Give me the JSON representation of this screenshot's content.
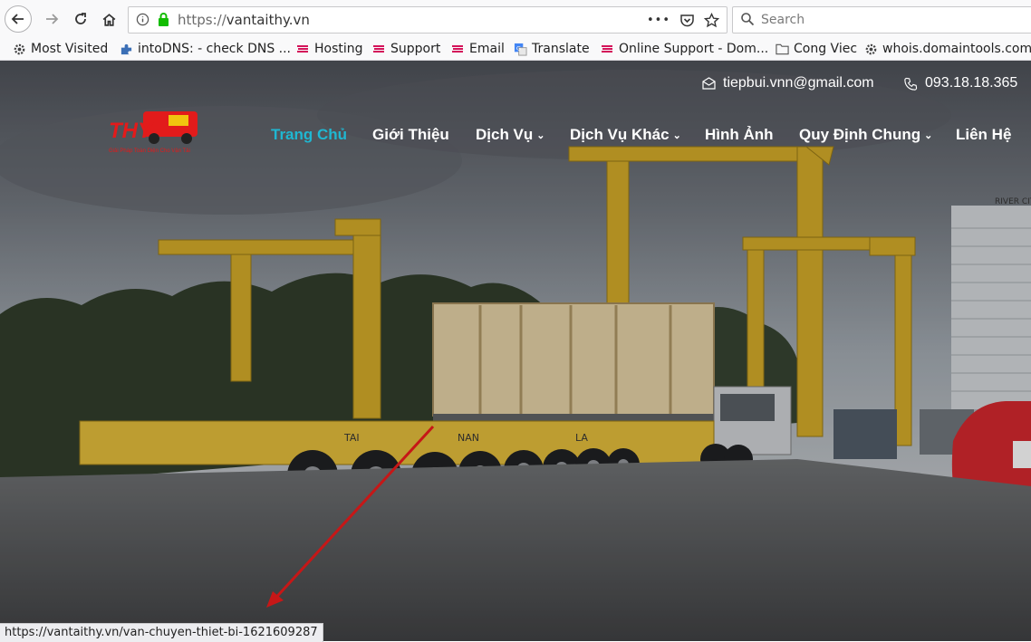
{
  "browser": {
    "url_scheme": "https://",
    "url_host": "vantaithy.vn",
    "search_placeholder": "Search",
    "page_actions_label": "•••"
  },
  "bookmarks": [
    {
      "label": "Most Visited",
      "icon": "gear-icon"
    },
    {
      "label": "intoDNS: - check DNS ...",
      "icon": "puzzle-icon"
    },
    {
      "label": "Hosting",
      "icon": "mat-bao-icon"
    },
    {
      "label": "Support",
      "icon": "mat-bao-icon"
    },
    {
      "label": "Email",
      "icon": "mat-bao-icon"
    },
    {
      "label": "Translate",
      "icon": "translate-icon"
    },
    {
      "label": "Online Support - Dom...",
      "icon": "mat-bao-icon"
    },
    {
      "label": "Cong Viec",
      "icon": "folder-icon"
    },
    {
      "label": "whois.domaintools.com",
      "icon": "gear-icon"
    }
  ],
  "site": {
    "logo_text": "THY",
    "logo_tagline": "Giải Pháp Toàn Diện Cho Vận Tải",
    "email": "tiepbui.vnn@gmail.com",
    "phone": "093.18.18.365",
    "menu": [
      {
        "label": "Trang Chủ",
        "active": true,
        "dropdown": false
      },
      {
        "label": "Giới Thiệu",
        "active": false,
        "dropdown": false
      },
      {
        "label": "Dịch Vụ",
        "active": false,
        "dropdown": true
      },
      {
        "label": "Dịch Vụ Khác",
        "active": false,
        "dropdown": true
      },
      {
        "label": "Hình Ảnh",
        "active": false,
        "dropdown": false
      },
      {
        "label": "Quy Định Chung",
        "active": false,
        "dropdown": true
      },
      {
        "label": "Liên Hệ",
        "active": false,
        "dropdown": false
      }
    ],
    "accent_color": "#1fb7d1",
    "hero_truck_text": [
      "TAI",
      "NAN",
      "LA"
    ],
    "hero_building_text": "RIVER CITY"
  },
  "status_url": "https://vantaithy.vn/van-chuyen-thiet-bi-1621609287"
}
